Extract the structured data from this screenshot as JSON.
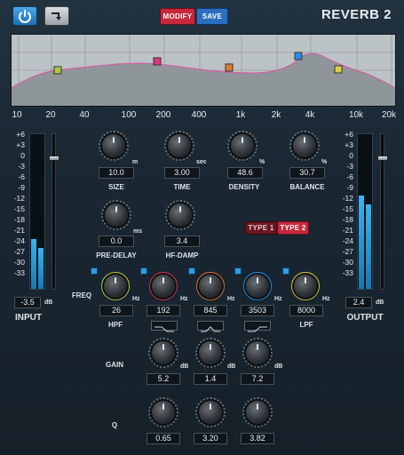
{
  "header": {
    "title": "REVERB 2",
    "modify_label": "MODIFY",
    "save_label": "SAVE",
    "power_icon": "power-icon",
    "preset_icon": "route-arrow-icon"
  },
  "graph": {
    "freq_labels": [
      "10",
      "20",
      "40",
      "100",
      "200",
      "400",
      "1k",
      "2k",
      "4k",
      "10k",
      "20k"
    ]
  },
  "input": {
    "label": "INPUT",
    "value": "-3.5",
    "unit": "dB",
    "scale": [
      "+6",
      "+3",
      "0",
      "-3",
      "-6",
      "-9",
      "-12",
      "-15",
      "-18",
      "-21",
      "-24",
      "-27",
      "-30",
      "-33"
    ]
  },
  "output": {
    "label": "OUTPUT",
    "value": "2.4",
    "unit": "dB",
    "scale": [
      "+6",
      "+3",
      "0",
      "-3",
      "-6",
      "-9",
      "-12",
      "-15",
      "-18",
      "-21",
      "-24",
      "-27",
      "-30",
      "-33"
    ]
  },
  "reverb": {
    "size": {
      "label": "SIZE",
      "value": "10.0",
      "unit": "m"
    },
    "time": {
      "label": "TIME",
      "value": "3.00",
      "unit": "sec"
    },
    "density": {
      "label": "DENSITY",
      "value": "48.6",
      "unit": "%"
    },
    "balance": {
      "label": "BALANCE",
      "value": "30.7",
      "unit": "%"
    },
    "predelay": {
      "label": "PRE-DELAY",
      "value": "0.0",
      "unit": "ms"
    },
    "hfdamp": {
      "label": "HF-DAMP",
      "value": "3.4"
    },
    "type1": "TYPE 1",
    "type2": "TYPE 2"
  },
  "eq": {
    "freq_label": "FREQ",
    "gain_label": "GAIN",
    "q_label": "Q",
    "hz": "Hz",
    "db": "dB",
    "hpf": {
      "label": "HPF",
      "value": "26"
    },
    "band1": {
      "freq": "192",
      "gain": "5.2",
      "q": "0.65"
    },
    "band2": {
      "freq": "845",
      "gain": "1.4",
      "q": "3.20"
    },
    "band3": {
      "freq": "3503",
      "gain": "7.2",
      "q": "3.82"
    },
    "lpf": {
      "label": "LPF",
      "value": "8000"
    }
  },
  "colors": {
    "accent": "#2aa0e6",
    "modify": "#c4283a",
    "save": "#2a6fc0",
    "hpf_knob": "#c8d23a",
    "band1_knob": "#d63a4a",
    "band2_knob": "#e07a30",
    "band3_knob": "#2a8fe6",
    "lpf_knob": "#e0d040"
  }
}
